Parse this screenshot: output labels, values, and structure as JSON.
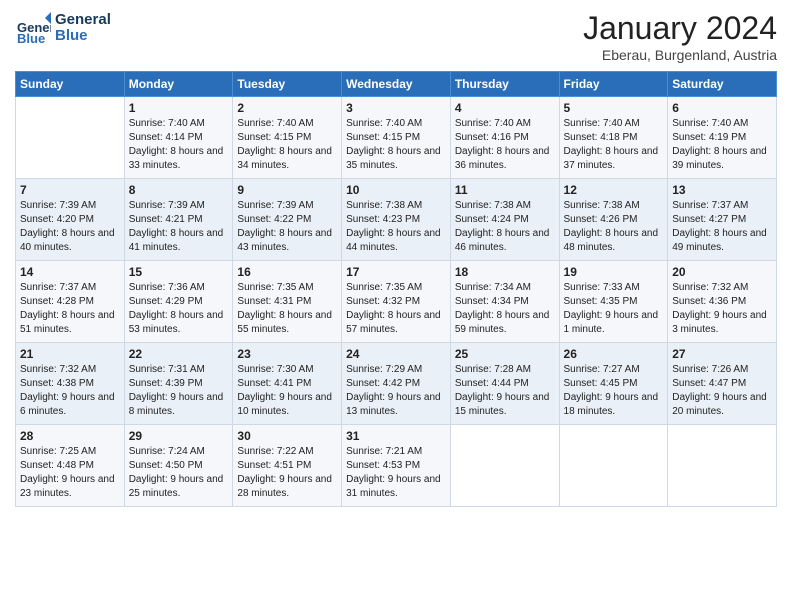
{
  "logo": {
    "general": "General",
    "blue": "Blue"
  },
  "title": "January 2024",
  "subtitle": "Eberau, Burgenland, Austria",
  "days_header": [
    "Sunday",
    "Monday",
    "Tuesday",
    "Wednesday",
    "Thursday",
    "Friday",
    "Saturday"
  ],
  "weeks": [
    [
      {
        "day": "",
        "sunrise": "",
        "sunset": "",
        "daylight": ""
      },
      {
        "day": "1",
        "sunrise": "Sunrise: 7:40 AM",
        "sunset": "Sunset: 4:14 PM",
        "daylight": "Daylight: 8 hours and 33 minutes."
      },
      {
        "day": "2",
        "sunrise": "Sunrise: 7:40 AM",
        "sunset": "Sunset: 4:15 PM",
        "daylight": "Daylight: 8 hours and 34 minutes."
      },
      {
        "day": "3",
        "sunrise": "Sunrise: 7:40 AM",
        "sunset": "Sunset: 4:15 PM",
        "daylight": "Daylight: 8 hours and 35 minutes."
      },
      {
        "day": "4",
        "sunrise": "Sunrise: 7:40 AM",
        "sunset": "Sunset: 4:16 PM",
        "daylight": "Daylight: 8 hours and 36 minutes."
      },
      {
        "day": "5",
        "sunrise": "Sunrise: 7:40 AM",
        "sunset": "Sunset: 4:18 PM",
        "daylight": "Daylight: 8 hours and 37 minutes."
      },
      {
        "day": "6",
        "sunrise": "Sunrise: 7:40 AM",
        "sunset": "Sunset: 4:19 PM",
        "daylight": "Daylight: 8 hours and 39 minutes."
      }
    ],
    [
      {
        "day": "7",
        "sunrise": "Sunrise: 7:39 AM",
        "sunset": "Sunset: 4:20 PM",
        "daylight": "Daylight: 8 hours and 40 minutes."
      },
      {
        "day": "8",
        "sunrise": "Sunrise: 7:39 AM",
        "sunset": "Sunset: 4:21 PM",
        "daylight": "Daylight: 8 hours and 41 minutes."
      },
      {
        "day": "9",
        "sunrise": "Sunrise: 7:39 AM",
        "sunset": "Sunset: 4:22 PM",
        "daylight": "Daylight: 8 hours and 43 minutes."
      },
      {
        "day": "10",
        "sunrise": "Sunrise: 7:38 AM",
        "sunset": "Sunset: 4:23 PM",
        "daylight": "Daylight: 8 hours and 44 minutes."
      },
      {
        "day": "11",
        "sunrise": "Sunrise: 7:38 AM",
        "sunset": "Sunset: 4:24 PM",
        "daylight": "Daylight: 8 hours and 46 minutes."
      },
      {
        "day": "12",
        "sunrise": "Sunrise: 7:38 AM",
        "sunset": "Sunset: 4:26 PM",
        "daylight": "Daylight: 8 hours and 48 minutes."
      },
      {
        "day": "13",
        "sunrise": "Sunrise: 7:37 AM",
        "sunset": "Sunset: 4:27 PM",
        "daylight": "Daylight: 8 hours and 49 minutes."
      }
    ],
    [
      {
        "day": "14",
        "sunrise": "Sunrise: 7:37 AM",
        "sunset": "Sunset: 4:28 PM",
        "daylight": "Daylight: 8 hours and 51 minutes."
      },
      {
        "day": "15",
        "sunrise": "Sunrise: 7:36 AM",
        "sunset": "Sunset: 4:29 PM",
        "daylight": "Daylight: 8 hours and 53 minutes."
      },
      {
        "day": "16",
        "sunrise": "Sunrise: 7:35 AM",
        "sunset": "Sunset: 4:31 PM",
        "daylight": "Daylight: 8 hours and 55 minutes."
      },
      {
        "day": "17",
        "sunrise": "Sunrise: 7:35 AM",
        "sunset": "Sunset: 4:32 PM",
        "daylight": "Daylight: 8 hours and 57 minutes."
      },
      {
        "day": "18",
        "sunrise": "Sunrise: 7:34 AM",
        "sunset": "Sunset: 4:34 PM",
        "daylight": "Daylight: 8 hours and 59 minutes."
      },
      {
        "day": "19",
        "sunrise": "Sunrise: 7:33 AM",
        "sunset": "Sunset: 4:35 PM",
        "daylight": "Daylight: 9 hours and 1 minute."
      },
      {
        "day": "20",
        "sunrise": "Sunrise: 7:32 AM",
        "sunset": "Sunset: 4:36 PM",
        "daylight": "Daylight: 9 hours and 3 minutes."
      }
    ],
    [
      {
        "day": "21",
        "sunrise": "Sunrise: 7:32 AM",
        "sunset": "Sunset: 4:38 PM",
        "daylight": "Daylight: 9 hours and 6 minutes."
      },
      {
        "day": "22",
        "sunrise": "Sunrise: 7:31 AM",
        "sunset": "Sunset: 4:39 PM",
        "daylight": "Daylight: 9 hours and 8 minutes."
      },
      {
        "day": "23",
        "sunrise": "Sunrise: 7:30 AM",
        "sunset": "Sunset: 4:41 PM",
        "daylight": "Daylight: 9 hours and 10 minutes."
      },
      {
        "day": "24",
        "sunrise": "Sunrise: 7:29 AM",
        "sunset": "Sunset: 4:42 PM",
        "daylight": "Daylight: 9 hours and 13 minutes."
      },
      {
        "day": "25",
        "sunrise": "Sunrise: 7:28 AM",
        "sunset": "Sunset: 4:44 PM",
        "daylight": "Daylight: 9 hours and 15 minutes."
      },
      {
        "day": "26",
        "sunrise": "Sunrise: 7:27 AM",
        "sunset": "Sunset: 4:45 PM",
        "daylight": "Daylight: 9 hours and 18 minutes."
      },
      {
        "day": "27",
        "sunrise": "Sunrise: 7:26 AM",
        "sunset": "Sunset: 4:47 PM",
        "daylight": "Daylight: 9 hours and 20 minutes."
      }
    ],
    [
      {
        "day": "28",
        "sunrise": "Sunrise: 7:25 AM",
        "sunset": "Sunset: 4:48 PM",
        "daylight": "Daylight: 9 hours and 23 minutes."
      },
      {
        "day": "29",
        "sunrise": "Sunrise: 7:24 AM",
        "sunset": "Sunset: 4:50 PM",
        "daylight": "Daylight: 9 hours and 25 minutes."
      },
      {
        "day": "30",
        "sunrise": "Sunrise: 7:22 AM",
        "sunset": "Sunset: 4:51 PM",
        "daylight": "Daylight: 9 hours and 28 minutes."
      },
      {
        "day": "31",
        "sunrise": "Sunrise: 7:21 AM",
        "sunset": "Sunset: 4:53 PM",
        "daylight": "Daylight: 9 hours and 31 minutes."
      },
      {
        "day": "",
        "sunrise": "",
        "sunset": "",
        "daylight": ""
      },
      {
        "day": "",
        "sunrise": "",
        "sunset": "",
        "daylight": ""
      },
      {
        "day": "",
        "sunrise": "",
        "sunset": "",
        "daylight": ""
      }
    ]
  ]
}
